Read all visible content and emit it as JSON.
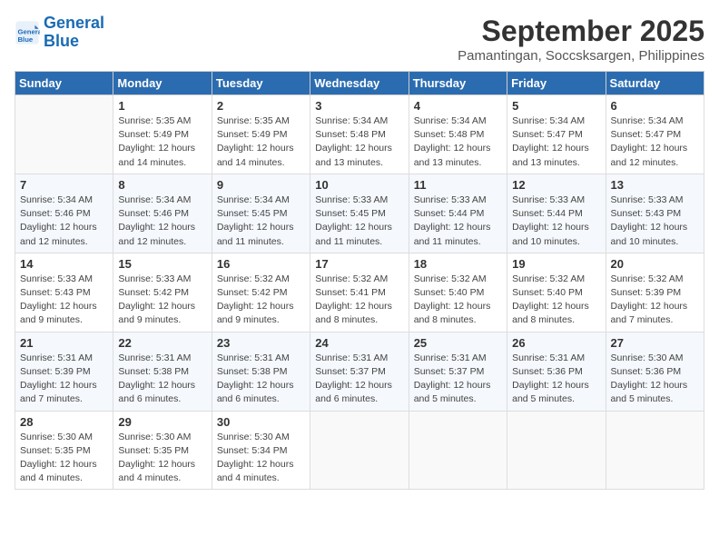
{
  "header": {
    "logo_line1": "General",
    "logo_line2": "Blue",
    "month": "September 2025",
    "location": "Pamantingan, Soccsksargen, Philippines"
  },
  "weekdays": [
    "Sunday",
    "Monday",
    "Tuesday",
    "Wednesday",
    "Thursday",
    "Friday",
    "Saturday"
  ],
  "weeks": [
    [
      {
        "day": "",
        "info": ""
      },
      {
        "day": "1",
        "info": "Sunrise: 5:35 AM\nSunset: 5:49 PM\nDaylight: 12 hours\nand 14 minutes."
      },
      {
        "day": "2",
        "info": "Sunrise: 5:35 AM\nSunset: 5:49 PM\nDaylight: 12 hours\nand 14 minutes."
      },
      {
        "day": "3",
        "info": "Sunrise: 5:34 AM\nSunset: 5:48 PM\nDaylight: 12 hours\nand 13 minutes."
      },
      {
        "day": "4",
        "info": "Sunrise: 5:34 AM\nSunset: 5:48 PM\nDaylight: 12 hours\nand 13 minutes."
      },
      {
        "day": "5",
        "info": "Sunrise: 5:34 AM\nSunset: 5:47 PM\nDaylight: 12 hours\nand 13 minutes."
      },
      {
        "day": "6",
        "info": "Sunrise: 5:34 AM\nSunset: 5:47 PM\nDaylight: 12 hours\nand 12 minutes."
      }
    ],
    [
      {
        "day": "7",
        "info": "Sunrise: 5:34 AM\nSunset: 5:46 PM\nDaylight: 12 hours\nand 12 minutes."
      },
      {
        "day": "8",
        "info": "Sunrise: 5:34 AM\nSunset: 5:46 PM\nDaylight: 12 hours\nand 12 minutes."
      },
      {
        "day": "9",
        "info": "Sunrise: 5:34 AM\nSunset: 5:45 PM\nDaylight: 12 hours\nand 11 minutes."
      },
      {
        "day": "10",
        "info": "Sunrise: 5:33 AM\nSunset: 5:45 PM\nDaylight: 12 hours\nand 11 minutes."
      },
      {
        "day": "11",
        "info": "Sunrise: 5:33 AM\nSunset: 5:44 PM\nDaylight: 12 hours\nand 11 minutes."
      },
      {
        "day": "12",
        "info": "Sunrise: 5:33 AM\nSunset: 5:44 PM\nDaylight: 12 hours\nand 10 minutes."
      },
      {
        "day": "13",
        "info": "Sunrise: 5:33 AM\nSunset: 5:43 PM\nDaylight: 12 hours\nand 10 minutes."
      }
    ],
    [
      {
        "day": "14",
        "info": "Sunrise: 5:33 AM\nSunset: 5:43 PM\nDaylight: 12 hours\nand 9 minutes."
      },
      {
        "day": "15",
        "info": "Sunrise: 5:33 AM\nSunset: 5:42 PM\nDaylight: 12 hours\nand 9 minutes."
      },
      {
        "day": "16",
        "info": "Sunrise: 5:32 AM\nSunset: 5:42 PM\nDaylight: 12 hours\nand 9 minutes."
      },
      {
        "day": "17",
        "info": "Sunrise: 5:32 AM\nSunset: 5:41 PM\nDaylight: 12 hours\nand 8 minutes."
      },
      {
        "day": "18",
        "info": "Sunrise: 5:32 AM\nSunset: 5:40 PM\nDaylight: 12 hours\nand 8 minutes."
      },
      {
        "day": "19",
        "info": "Sunrise: 5:32 AM\nSunset: 5:40 PM\nDaylight: 12 hours\nand 8 minutes."
      },
      {
        "day": "20",
        "info": "Sunrise: 5:32 AM\nSunset: 5:39 PM\nDaylight: 12 hours\nand 7 minutes."
      }
    ],
    [
      {
        "day": "21",
        "info": "Sunrise: 5:31 AM\nSunset: 5:39 PM\nDaylight: 12 hours\nand 7 minutes."
      },
      {
        "day": "22",
        "info": "Sunrise: 5:31 AM\nSunset: 5:38 PM\nDaylight: 12 hours\nand 6 minutes."
      },
      {
        "day": "23",
        "info": "Sunrise: 5:31 AM\nSunset: 5:38 PM\nDaylight: 12 hours\nand 6 minutes."
      },
      {
        "day": "24",
        "info": "Sunrise: 5:31 AM\nSunset: 5:37 PM\nDaylight: 12 hours\nand 6 minutes."
      },
      {
        "day": "25",
        "info": "Sunrise: 5:31 AM\nSunset: 5:37 PM\nDaylight: 12 hours\nand 5 minutes."
      },
      {
        "day": "26",
        "info": "Sunrise: 5:31 AM\nSunset: 5:36 PM\nDaylight: 12 hours\nand 5 minutes."
      },
      {
        "day": "27",
        "info": "Sunrise: 5:30 AM\nSunset: 5:36 PM\nDaylight: 12 hours\nand 5 minutes."
      }
    ],
    [
      {
        "day": "28",
        "info": "Sunrise: 5:30 AM\nSunset: 5:35 PM\nDaylight: 12 hours\nand 4 minutes."
      },
      {
        "day": "29",
        "info": "Sunrise: 5:30 AM\nSunset: 5:35 PM\nDaylight: 12 hours\nand 4 minutes."
      },
      {
        "day": "30",
        "info": "Sunrise: 5:30 AM\nSunset: 5:34 PM\nDaylight: 12 hours\nand 4 minutes."
      },
      {
        "day": "",
        "info": ""
      },
      {
        "day": "",
        "info": ""
      },
      {
        "day": "",
        "info": ""
      },
      {
        "day": "",
        "info": ""
      }
    ]
  ]
}
